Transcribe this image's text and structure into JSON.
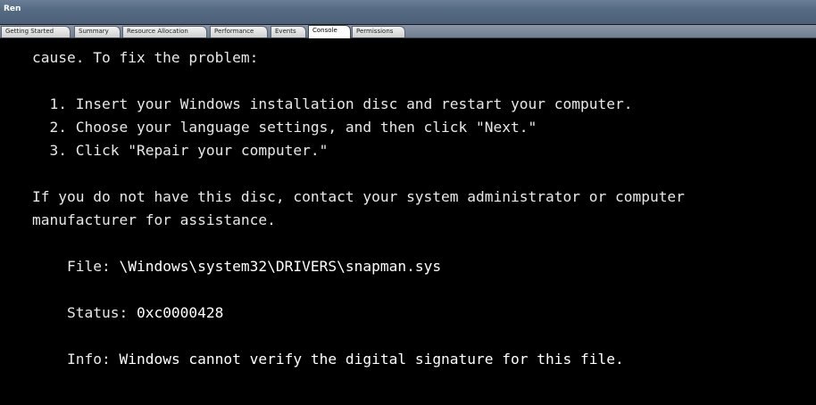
{
  "window": {
    "title": "Ren"
  },
  "tabs": [
    {
      "label": "Getting Started",
      "active": false
    },
    {
      "label": "Summary",
      "active": false
    },
    {
      "label": "Resource Allocation",
      "active": false
    },
    {
      "label": "Performance",
      "active": false
    },
    {
      "label": "Events",
      "active": false
    },
    {
      "label": "Console",
      "active": true
    },
    {
      "label": "Permissions",
      "active": false
    }
  ],
  "console": {
    "lines": [
      "cause. To fix the problem:",
      "",
      "  1. Insert your Windows installation disc and restart your computer.",
      "  2. Choose your language settings, and then click \"Next.\"",
      "  3. Click \"Repair your computer.\"",
      "",
      "If you do not have this disc, contact your system administrator or computer",
      "manufacturer for assistance.",
      "",
      "File: \\Windows\\system32\\DRIVERS\\snapman.sys",
      "",
      "Status: 0xc0000428",
      "",
      "Info: Windows cannot verify the digital signature for this file."
    ],
    "file_label": "File: ",
    "file_value": "\\Windows\\system32\\DRIVERS\\snapman.sys",
    "status_label": "Status: ",
    "status_value": "0xc0000428",
    "info_label": "Info: ",
    "info_value": "Windows cannot verify the digital signature for this file."
  },
  "colors": {
    "titlebar": "#556a83",
    "console_bg": "#000000",
    "console_text": "#e8e8e8",
    "console_bright": "#ffffff"
  }
}
